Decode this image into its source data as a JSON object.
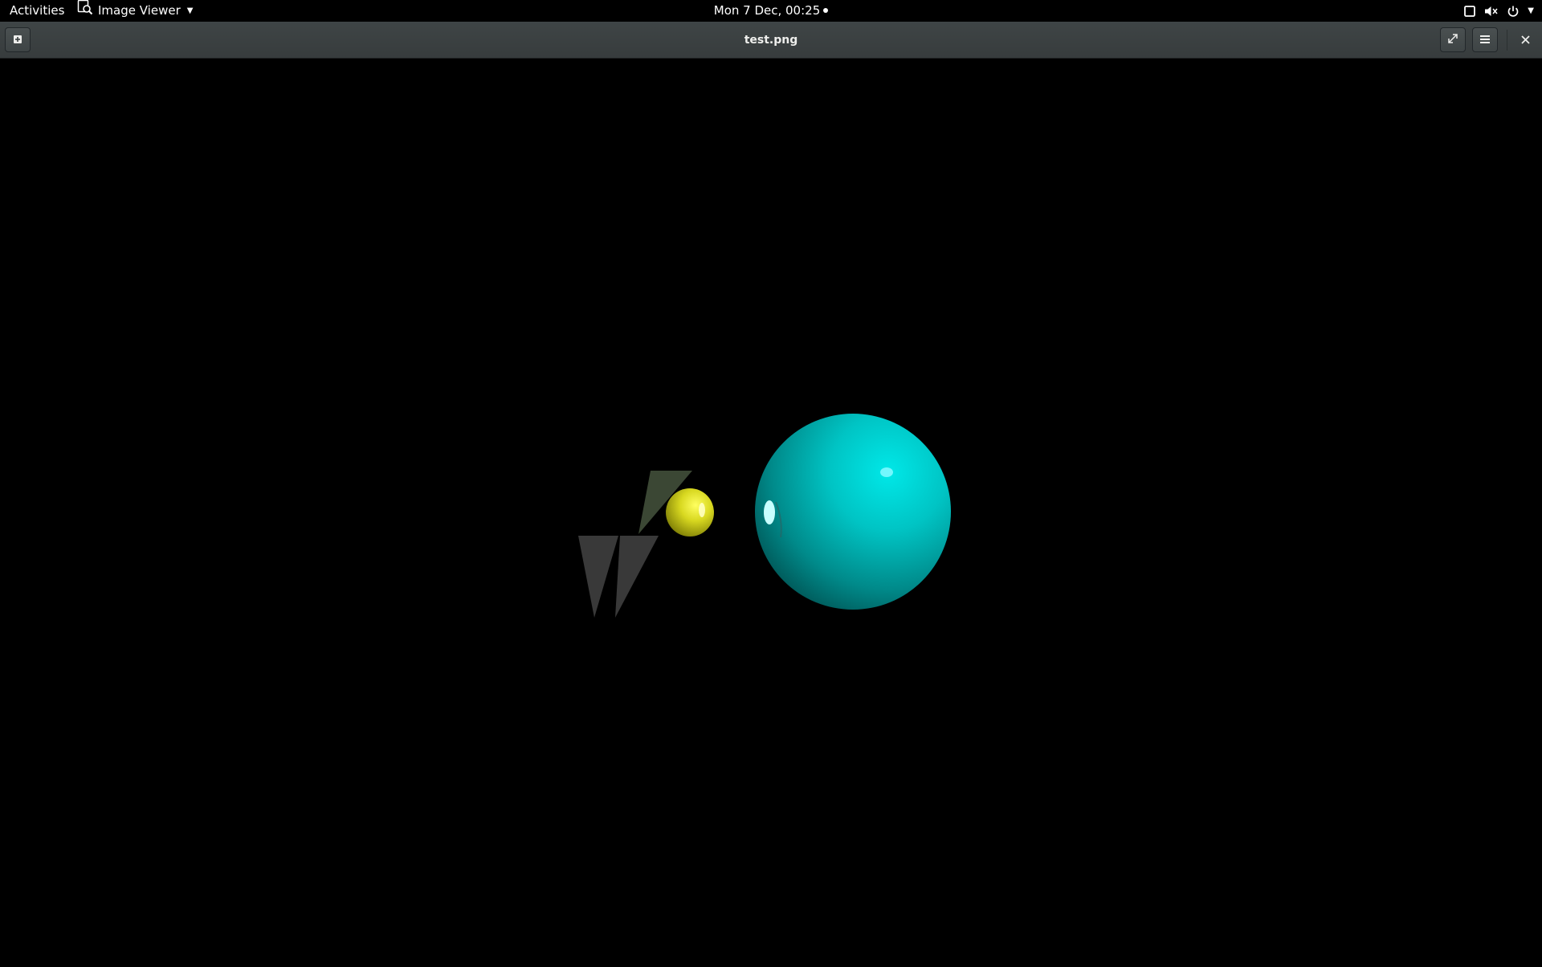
{
  "topbar": {
    "activities": "Activities",
    "app_name": "Image Viewer",
    "app_icon": "image-viewer-icon",
    "clock": "Mon  7 Dec, 00:25",
    "status_icons": [
      "window-icon",
      "volume-muted-icon",
      "power-icon",
      "chevron-down-icon"
    ]
  },
  "window": {
    "title": "test.png",
    "buttons": {
      "new_window_icon": "new-window-icon",
      "fullscreen_icon": "fullscreen-icon",
      "menu_icon": "hamburger-menu-icon",
      "close_icon": "close-icon"
    }
  },
  "image": {
    "description_colors": {
      "background": "#000000",
      "large_sphere": "#00c8c8",
      "small_sphere": "#e0e020",
      "triangles": "#3a3a3a",
      "green_triangle": "#3d4a34"
    }
  }
}
